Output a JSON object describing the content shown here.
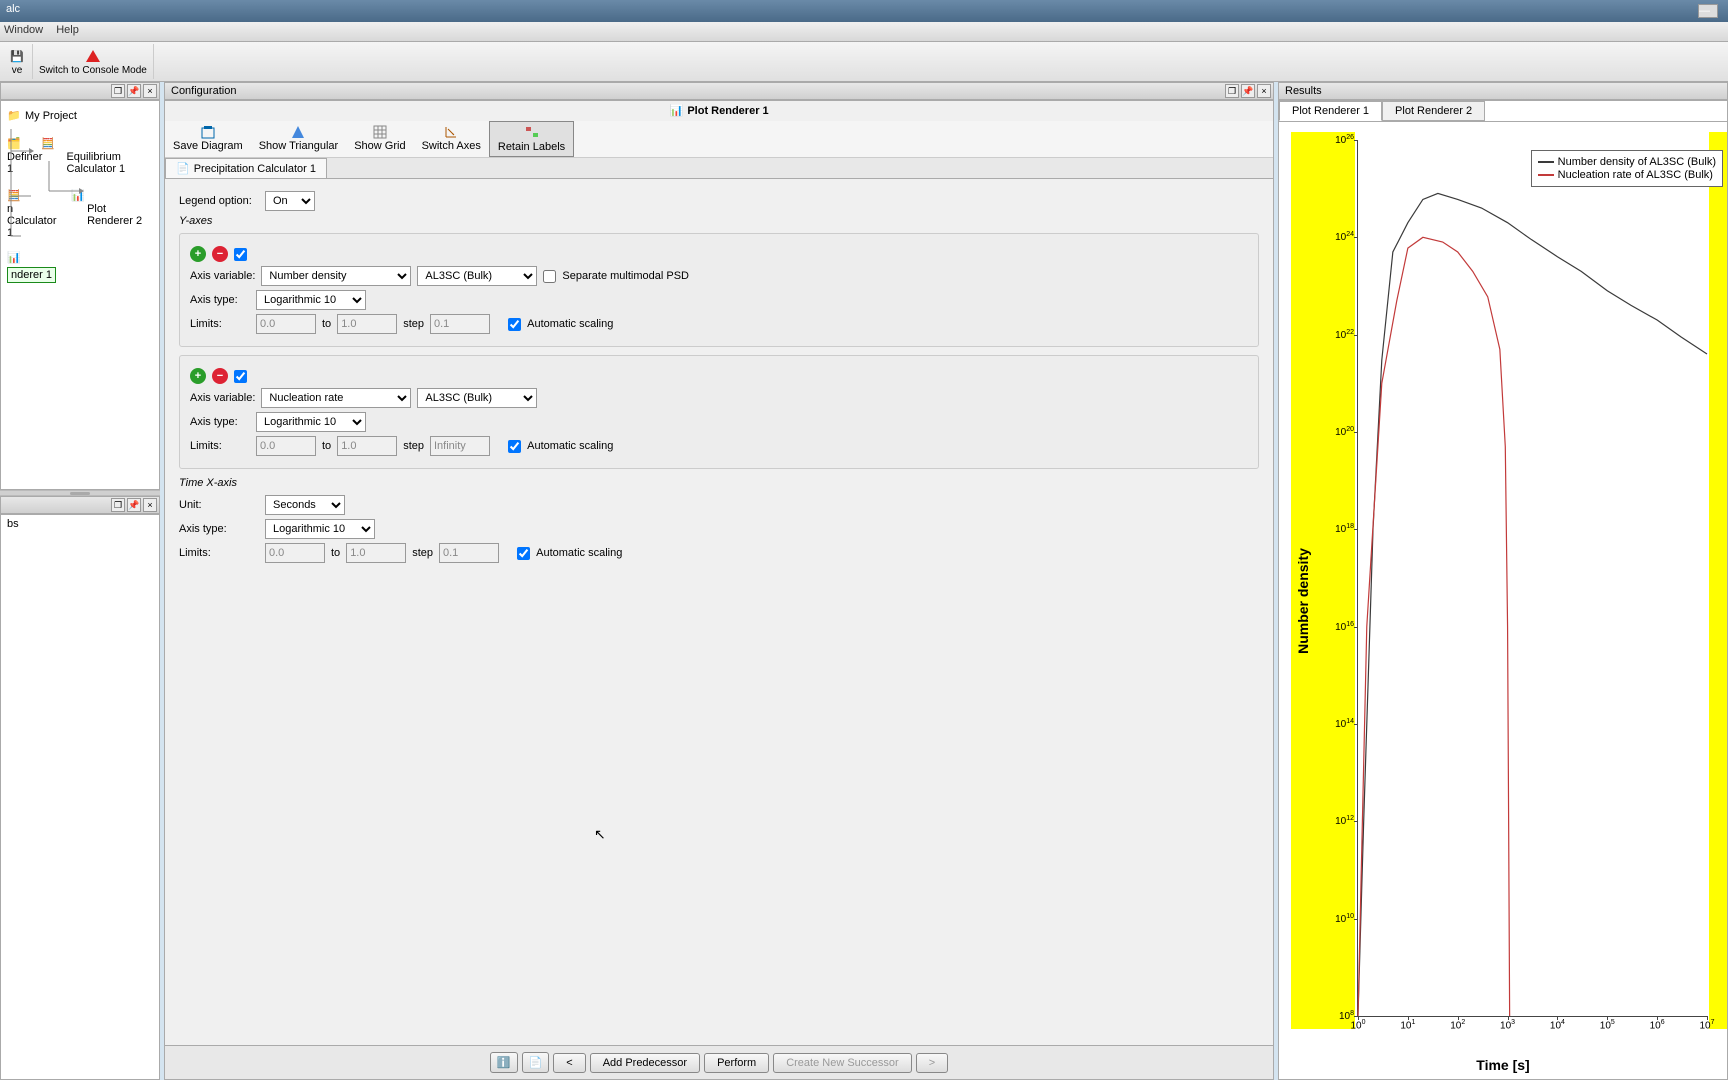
{
  "window": {
    "title": "alc"
  },
  "menubar": {
    "window": "Window",
    "help": "Help"
  },
  "toolbar": {
    "save": "ve",
    "console": "Switch to Console Mode"
  },
  "tree": {
    "project": "My Project",
    "definer": "Definer 1",
    "eqcalc": "Equilibrium Calculator 1",
    "ncalc": "n Calculator 1",
    "plot2": "Plot Renderer 2",
    "renderer1": "nderer 1"
  },
  "left_bottom": {
    "title": "bs"
  },
  "config": {
    "title": "Configuration",
    "subtitle": "Plot Renderer 1",
    "plot_toolbar": {
      "save_diagram": "Save Diagram",
      "show_triangular": "Show Triangular",
      "show_grid": "Show Grid",
      "switch_axes": "Switch Axes",
      "retain_labels": "Retain Labels"
    },
    "tab": "Precipitation Calculator 1",
    "legend_option_label": "Legend option:",
    "legend_option_value": "On",
    "yaxes_title": "Y-axes",
    "axis1": {
      "variable_label": "Axis variable:",
      "variable": "Number density",
      "phase": "AL3SC (Bulk)",
      "separate_label": "Separate multimodal PSD",
      "type_label": "Axis type:",
      "type": "Logarithmic 10",
      "limits_label": "Limits:",
      "from": "0.0",
      "to_label": "to",
      "to": "1.0",
      "step_label": "step",
      "step": "0.1",
      "auto_label": "Automatic scaling"
    },
    "axis2": {
      "variable_label": "Axis variable:",
      "variable": "Nucleation rate",
      "phase": "AL3SC (Bulk)",
      "type_label": "Axis type:",
      "type": "Logarithmic 10",
      "limits_label": "Limits:",
      "from": "0.0",
      "to_label": "to",
      "to": "1.0",
      "step_label": "step",
      "step": "Infinity",
      "auto_label": "Automatic scaling"
    },
    "xaxis": {
      "title": "Time X-axis",
      "unit_label": "Unit:",
      "unit": "Seconds",
      "type_label": "Axis type:",
      "type": "Logarithmic 10",
      "limits_label": "Limits:",
      "from": "0.0",
      "to_label": "to",
      "to": "1.0",
      "step_label": "step",
      "step": "0.1",
      "auto_label": "Automatic scaling"
    },
    "buttons": {
      "back": "<",
      "add_pred": "Add Predecessor",
      "perform": "Perform",
      "create_succ": "Create New Successor",
      "fwd": ">"
    }
  },
  "results": {
    "title": "Results",
    "tab1": "Plot Renderer 1",
    "tab2": "Plot Renderer 2",
    "legend1": "Number density of AL3SC (Bulk)",
    "legend2": "Nucleation rate of AL3SC (Bulk)",
    "xlabel": "Time [s]",
    "ylabel": "Number density"
  },
  "chart_data": {
    "type": "line",
    "xlabel": "Time [s]",
    "ylabel": "Number density",
    "xscale": "log10",
    "yscale": "log10",
    "xlim": [
      1,
      10000000.0
    ],
    "ylim": [
      100000000.0,
      1e+26
    ],
    "xticks": [
      1,
      10,
      100,
      1000,
      10000,
      100000,
      1000000,
      10000000
    ],
    "yticks": [
      100000000.0,
      10000000000.0,
      1000000000000.0,
      100000000000000.0,
      1e+16,
      1e+18,
      1e+20,
      1e+22,
      1e+24,
      1e+26
    ],
    "series": [
      {
        "name": "Number density of AL3SC (Bulk)",
        "color": "#3a3a3a",
        "x": [
          1,
          1.3,
          2,
          3,
          5,
          10,
          20,
          40,
          100,
          300,
          1000,
          3000,
          10000,
          30000,
          100000,
          300000,
          1000000,
          3000000,
          10000000.0
        ],
        "y": [
          100000000.0,
          1000000000000.0,
          1e+18,
          3e+21,
          5e+23,
          2e+24,
          6e+24,
          8e+24,
          6e+24,
          4e+24,
          2e+24,
          9e+23,
          4e+23,
          2e+23,
          8e+22,
          4e+22,
          2e+22,
          9e+21,
          4e+21
        ]
      },
      {
        "name": "Nucleation rate of AL3SC (Bulk)",
        "color": "#c23a3a",
        "x": [
          1,
          1.5,
          3,
          6,
          10,
          20,
          50,
          100,
          200,
          400,
          700,
          900,
          1000,
          1050,
          1100
        ],
        "y": [
          100000000.0,
          1e+16,
          1e+21,
          5e+22,
          6e+23,
          1e+24,
          8e+23,
          5e+23,
          2e+23,
          6e+22,
          5e+21,
          5e+19,
          1e+16,
          1000000000000.0,
          100000000.0
        ]
      }
    ]
  }
}
